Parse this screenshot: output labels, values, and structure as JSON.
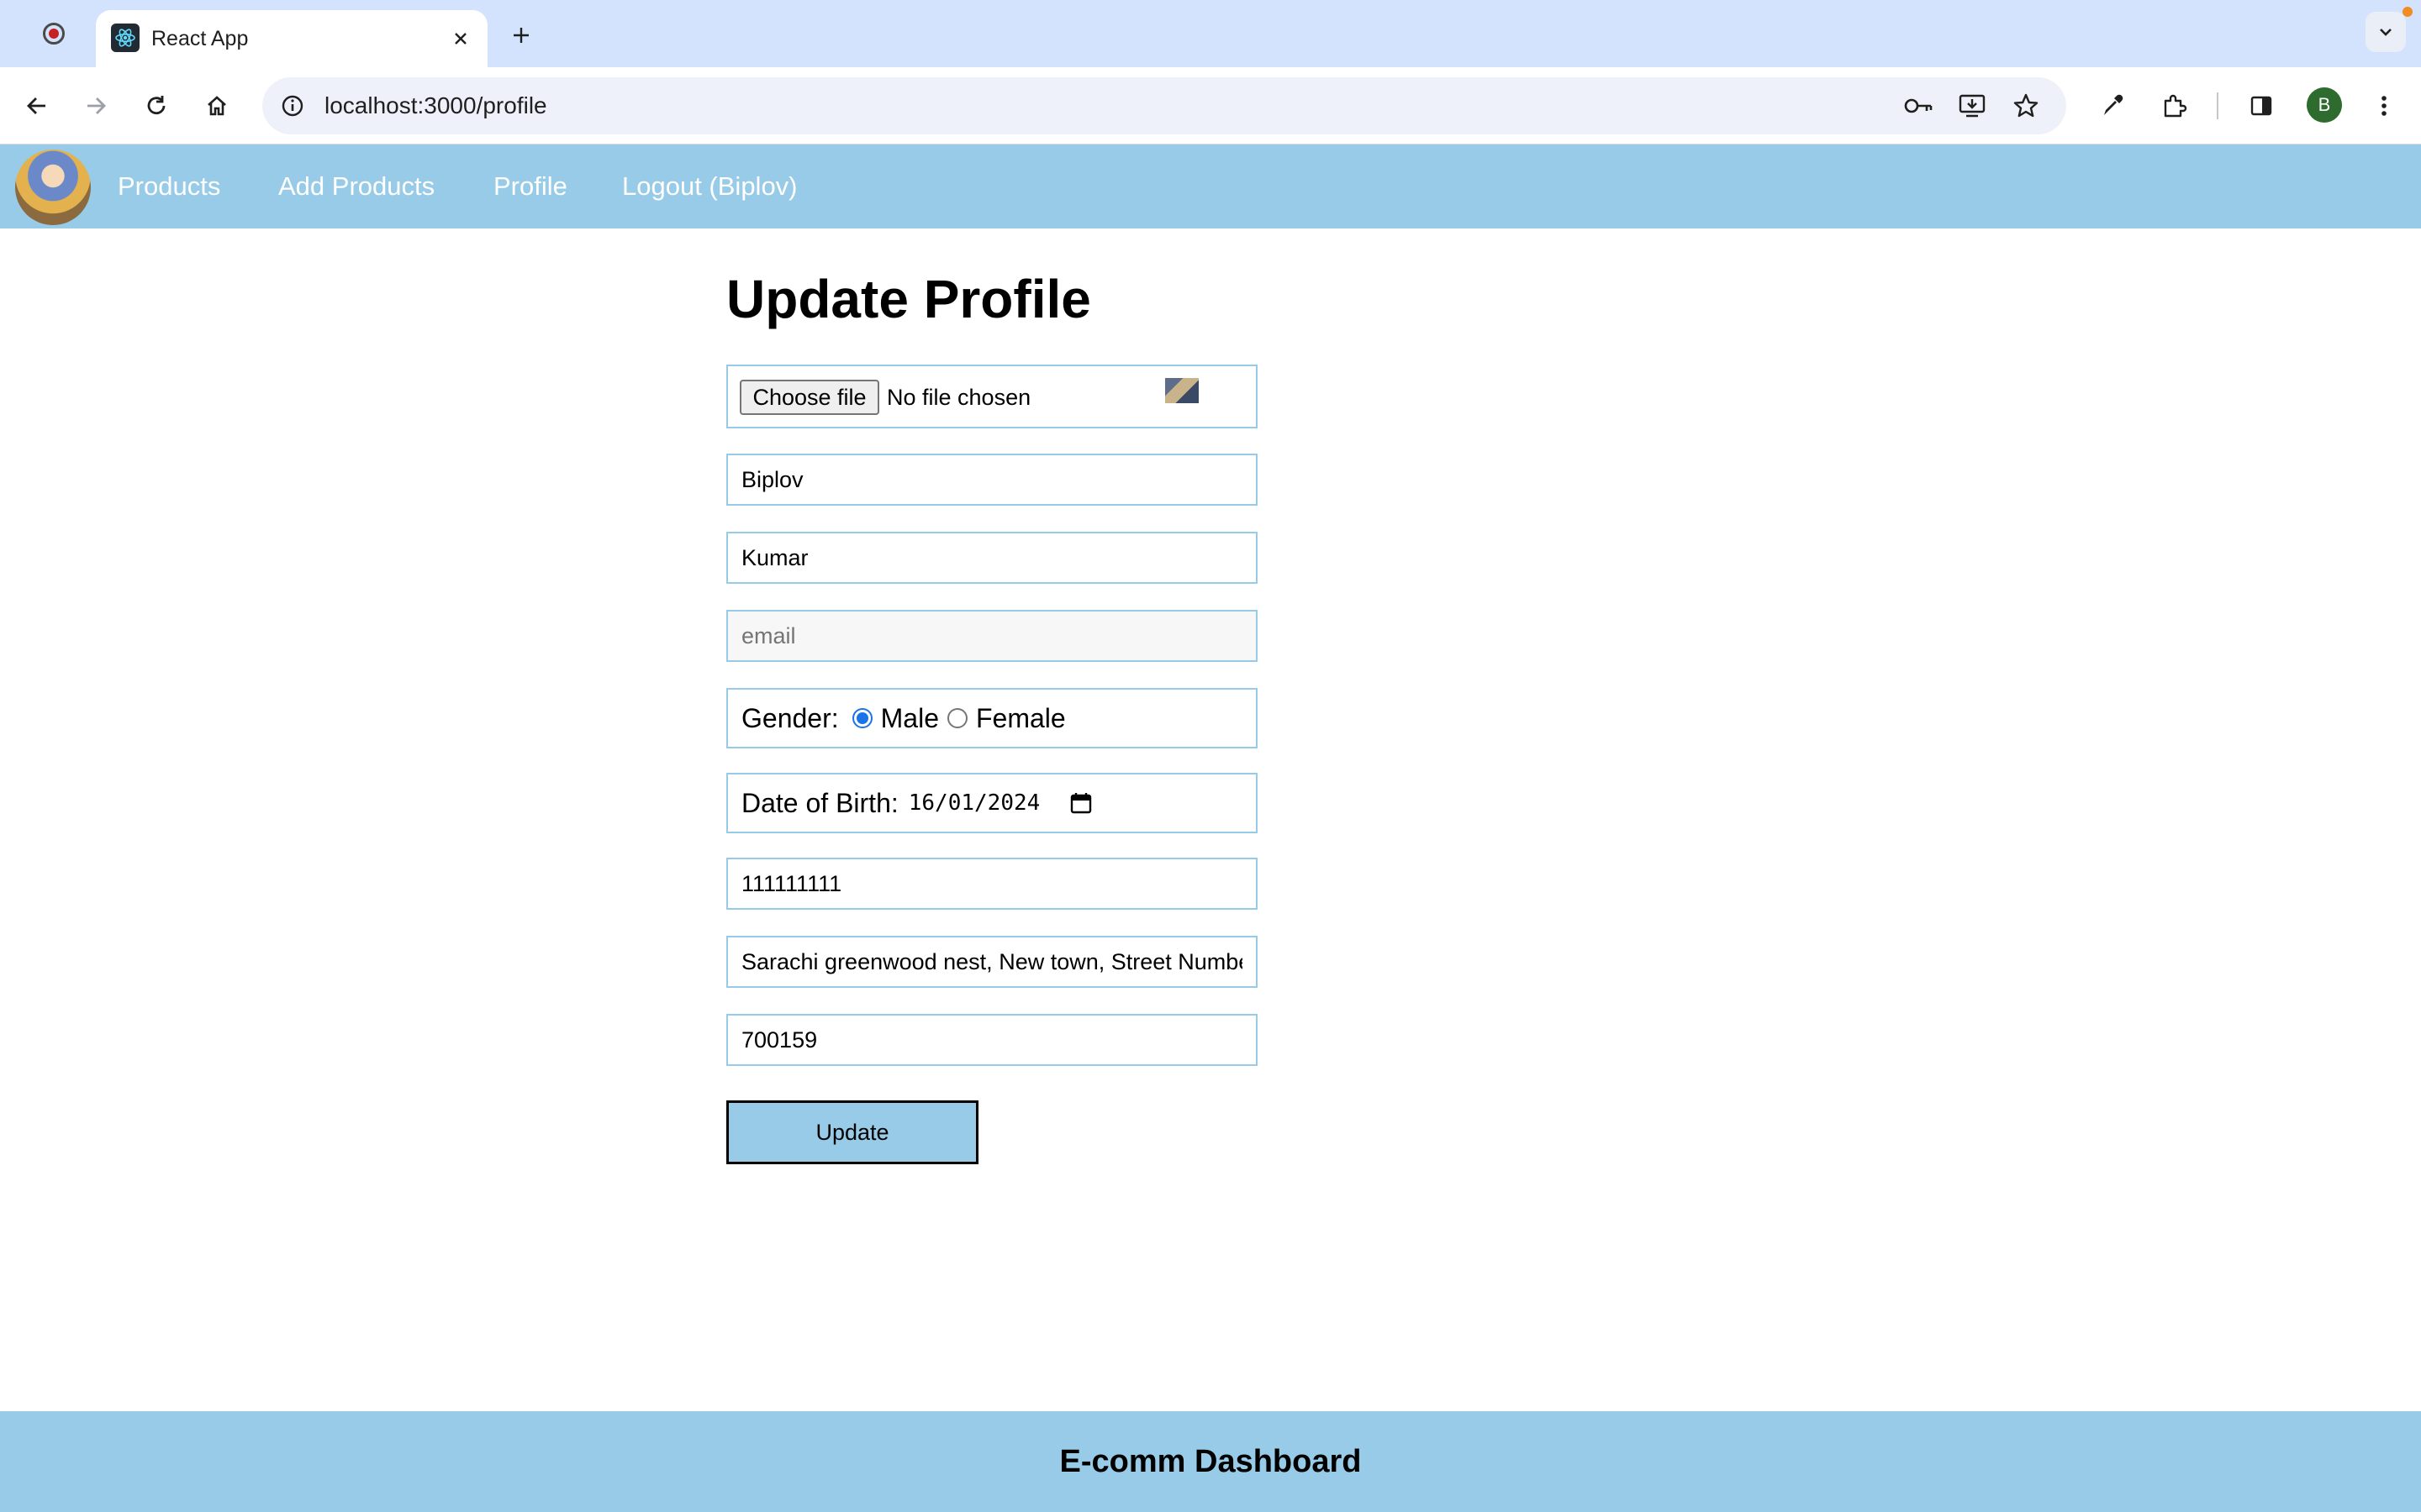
{
  "browser": {
    "tab_title": "React App",
    "url": "localhost:3000/profile",
    "profile_initial": "B",
    "accent_color": "#1a73e8"
  },
  "nav": {
    "links": [
      "Products",
      "Add Products",
      "Profile",
      "Logout (Biplov)"
    ],
    "background_color": "#98cbe7"
  },
  "form": {
    "title": "Update Profile",
    "file": {
      "button_label": "Choose file",
      "status": "No file chosen"
    },
    "first_name": {
      "value": "Biplov"
    },
    "last_name": {
      "value": "Kumar"
    },
    "email": {
      "value": "",
      "placeholder": "email"
    },
    "gender": {
      "label": "Gender:",
      "options": [
        "Male",
        "Female"
      ],
      "selected": "Male"
    },
    "dob": {
      "label": "Date of Birth:",
      "value": "16/01/2024"
    },
    "phone": {
      "value": "111111111"
    },
    "address": {
      "value": "Sarachi greenwood nest, New town, Street Numbe"
    },
    "pincode": {
      "value": "700159"
    },
    "submit_label": "Update"
  },
  "footer": {
    "title": "E-comm Dashboard"
  }
}
